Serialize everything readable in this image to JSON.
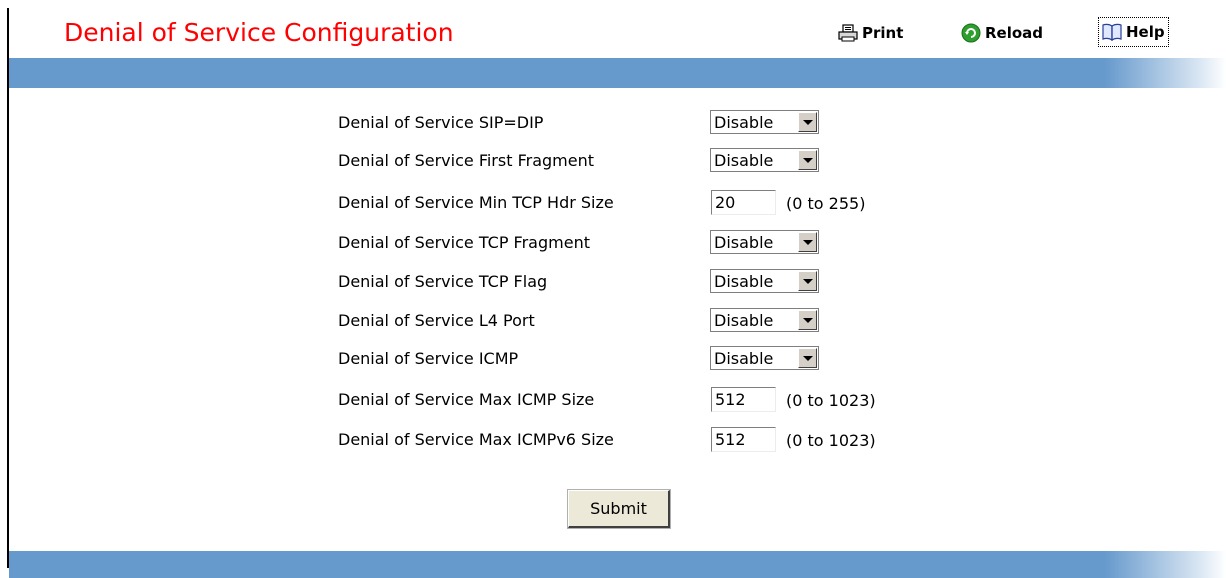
{
  "header": {
    "title": "Denial of Service Configuration",
    "title_color": "#ff0000",
    "print_label": "Print",
    "reload_label": "Reload",
    "help_label": "Help",
    "print_icon": "printer-icon",
    "reload_icon": "reload-icon",
    "help_icon": "help-book-icon"
  },
  "colors": {
    "band": "#6699cc",
    "reload_green": "#2e9e2e"
  },
  "form": {
    "rows": [
      {
        "label": "Denial of Service SIP=DIP",
        "type": "select",
        "value": "Disable"
      },
      {
        "label": "Denial of Service First Fragment",
        "type": "select",
        "value": "Disable"
      },
      {
        "label": "Denial of Service Min TCP Hdr Size",
        "type": "text",
        "value": "20",
        "range": "(0 to 255)"
      },
      {
        "label": "Denial of Service TCP Fragment",
        "type": "select",
        "value": "Disable"
      },
      {
        "label": "Denial of Service TCP Flag",
        "type": "select",
        "value": "Disable"
      },
      {
        "label": "Denial of Service L4 Port",
        "type": "select",
        "value": "Disable"
      },
      {
        "label": "Denial of Service ICMP",
        "type": "select",
        "value": "Disable"
      },
      {
        "label": "Denial of Service Max ICMP Size",
        "type": "text",
        "value": "512",
        "range": "(0 to 1023)"
      },
      {
        "label": "Denial of Service Max ICMPv6 Size",
        "type": "text",
        "value": "512",
        "range": "(0 to 1023)"
      }
    ],
    "submit_label": "Submit"
  }
}
